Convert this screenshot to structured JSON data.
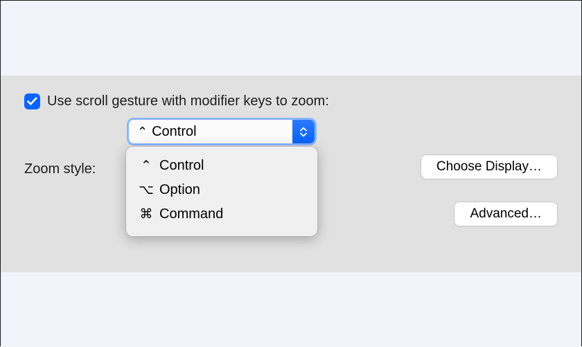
{
  "checkbox": {
    "checked": true,
    "label": "Use scroll gesture with modifier keys to zoom:"
  },
  "modifier_dropdown": {
    "selected_symbol": "⌃",
    "selected_label": "Control",
    "options": [
      {
        "symbol": "⌃",
        "label": "Control"
      },
      {
        "symbol": "⌥",
        "label": "Option"
      },
      {
        "symbol": "⌘",
        "label": "Command"
      }
    ]
  },
  "zoom_style_label": "Zoom style:",
  "buttons": {
    "choose_display": "Choose Display…",
    "advanced": "Advanced…"
  },
  "colors": {
    "accent": "#0a63ff",
    "panel_bg": "#e1e1e1",
    "page_bg": "#f1f4fb"
  }
}
